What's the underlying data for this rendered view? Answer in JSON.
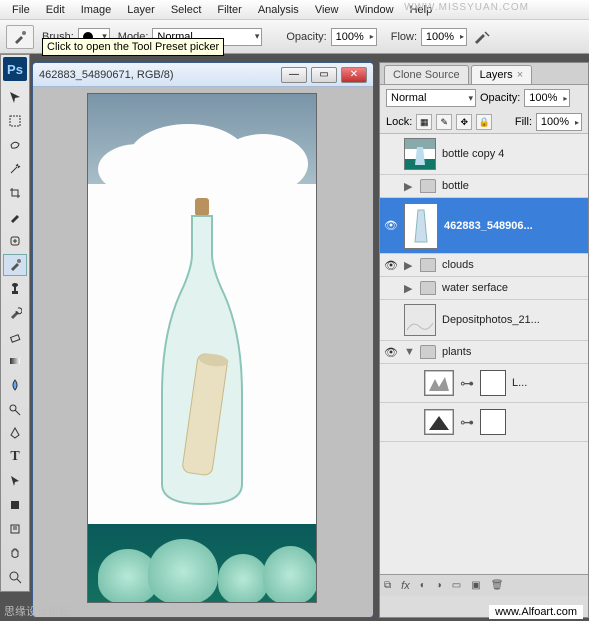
{
  "menu": [
    "File",
    "Edit",
    "Image",
    "Layer",
    "Select",
    "Filter",
    "Analysis",
    "View",
    "Window",
    "Help"
  ],
  "options": {
    "brush_label": "Brush:",
    "mode_label": "Mode:",
    "mode_value": "Normal",
    "opacity_label": "Opacity:",
    "opacity_value": "100%",
    "flow_label": "Flow:",
    "flow_value": "100%"
  },
  "tooltip": "Click to open the Tool Preset picker",
  "doc": {
    "title": "462883_54890671, RGB/8)"
  },
  "panels": {
    "tabs": {
      "clone": "Clone Source",
      "layers": "Layers"
    },
    "blend": "Normal",
    "opacity_label": "Opacity:",
    "opacity_value": "100%",
    "lock_label": "Lock:",
    "fill_label": "Fill:",
    "fill_value": "100%"
  },
  "layers": {
    "l0": "bottle copy 4",
    "l1": "bottle",
    "l2": "462883_548906...",
    "l3": "clouds",
    "l4": "water serface",
    "l5": "Depositphotos_21...",
    "l6": "plants",
    "adj": "L..."
  },
  "footer": {
    "left": "思缘设计论坛",
    "right": "www.Alfoart.com"
  },
  "watermark": "WWW.MISSYUAN.COM"
}
